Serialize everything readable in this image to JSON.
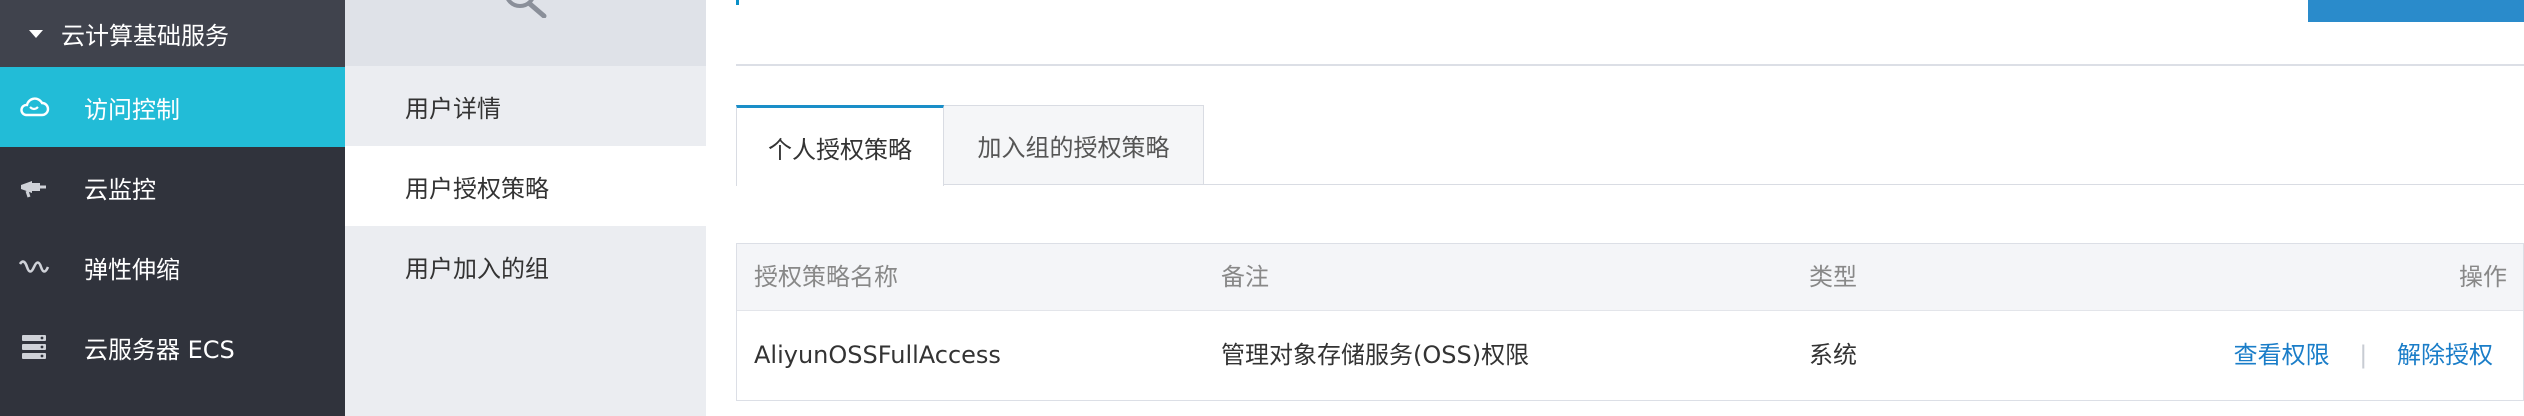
{
  "sidebar": {
    "group_label": "云计算基础服务",
    "items": [
      {
        "label": "访问控制",
        "icon": "cloud-icon",
        "active": true
      },
      {
        "label": "云监控",
        "icon": "monitor-icon",
        "active": false
      },
      {
        "label": "弹性伸缩",
        "icon": "scaling-icon",
        "active": false
      },
      {
        "label": "云服务器 ECS",
        "icon": "server-icon",
        "active": false
      }
    ]
  },
  "submenu": {
    "items": [
      {
        "label": "用户详情"
      },
      {
        "label": "用户授权策略"
      },
      {
        "label": "用户加入的组"
      }
    ]
  },
  "tabs": [
    {
      "label": "个人授权策略"
    },
    {
      "label": "加入组的授权策略"
    }
  ],
  "table": {
    "columns": [
      "授权策略名称",
      "备注",
      "类型",
      "操作"
    ],
    "rows": [
      {
        "name": "AliyunOSSFullAccess",
        "note": "管理对象存储服务(OSS)权限",
        "type": "系统",
        "actions": {
          "view": "查看权限",
          "separator": "|",
          "revoke": "解除授权"
        }
      }
    ]
  },
  "colors": {
    "sidebar_bg": "#30333c",
    "active_accent": "#22bcd7",
    "link": "#1a7dc8",
    "tab_active_border": "#1a8ec8"
  }
}
